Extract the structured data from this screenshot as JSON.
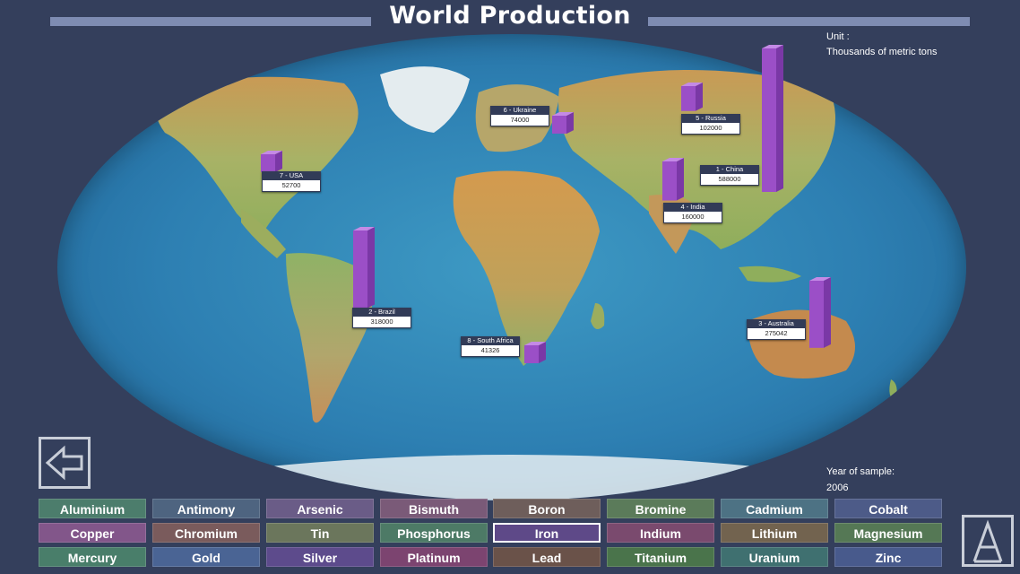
{
  "title": "World Production",
  "unit": {
    "label": "Unit :",
    "value": "Thousands of metric tons"
  },
  "year": {
    "label": "Year of sample:",
    "value": "2006"
  },
  "countries": [
    {
      "name": "1 - China",
      "value": 588000
    },
    {
      "name": "2 - Brazil",
      "value": 318000
    },
    {
      "name": "3 - Australia",
      "value": 275042
    },
    {
      "name": "4 - India",
      "value": 160000
    },
    {
      "name": "5 - Russia",
      "value": 102000
    },
    {
      "name": "6 - Ukraine",
      "value": 74000
    },
    {
      "name": "7 - USA",
      "value": 52700
    },
    {
      "name": "8 - South Africa",
      "value": 41326
    }
  ],
  "minerals": [
    {
      "label": "Aluminium",
      "color": "#4c7d6c"
    },
    {
      "label": "Antimony",
      "color": "#4e6480"
    },
    {
      "label": "Arsenic",
      "color": "#6a5c87"
    },
    {
      "label": "Bismuth",
      "color": "#7a5a78"
    },
    {
      "label": "Boron",
      "color": "#6e5e5b"
    },
    {
      "label": "Bromine",
      "color": "#5b7b5a"
    },
    {
      "label": "Cadmium",
      "color": "#4d7284"
    },
    {
      "label": "Cobalt",
      "color": "#4d5b88"
    },
    {
      "label": "Copper",
      "color": "#82568a"
    },
    {
      "label": "Chromium",
      "color": "#7a5b5c"
    },
    {
      "label": "Tin",
      "color": "#6b765c"
    },
    {
      "label": "Phosphorus",
      "color": "#4d7a66"
    },
    {
      "label": "Iron",
      "color": "#5e4988"
    },
    {
      "label": "Indium",
      "color": "#7a4a6e"
    },
    {
      "label": "Lithium",
      "color": "#72634f"
    },
    {
      "label": "Magnesium",
      "color": "#557855"
    },
    {
      "label": "Mercury",
      "color": "#497e6a"
    },
    {
      "label": "Gold",
      "color": "#4a6494"
    },
    {
      "label": "Silver",
      "color": "#5d4b8c"
    },
    {
      "label": "Platinum",
      "color": "#7c4470"
    },
    {
      "label": "Lead",
      "color": "#6a5249"
    },
    {
      "label": "Titanium",
      "color": "#4a744b"
    },
    {
      "label": "Uranium",
      "color": "#3f7070"
    },
    {
      "label": "Zinc",
      "color": "#485a8c"
    }
  ],
  "selected_mineral": "Iron",
  "colors": {
    "bar": "#9b4fc7",
    "background": "#343f5c"
  },
  "icons": {
    "back": "back-arrow-icon",
    "logo": "app-logo-icon"
  }
}
